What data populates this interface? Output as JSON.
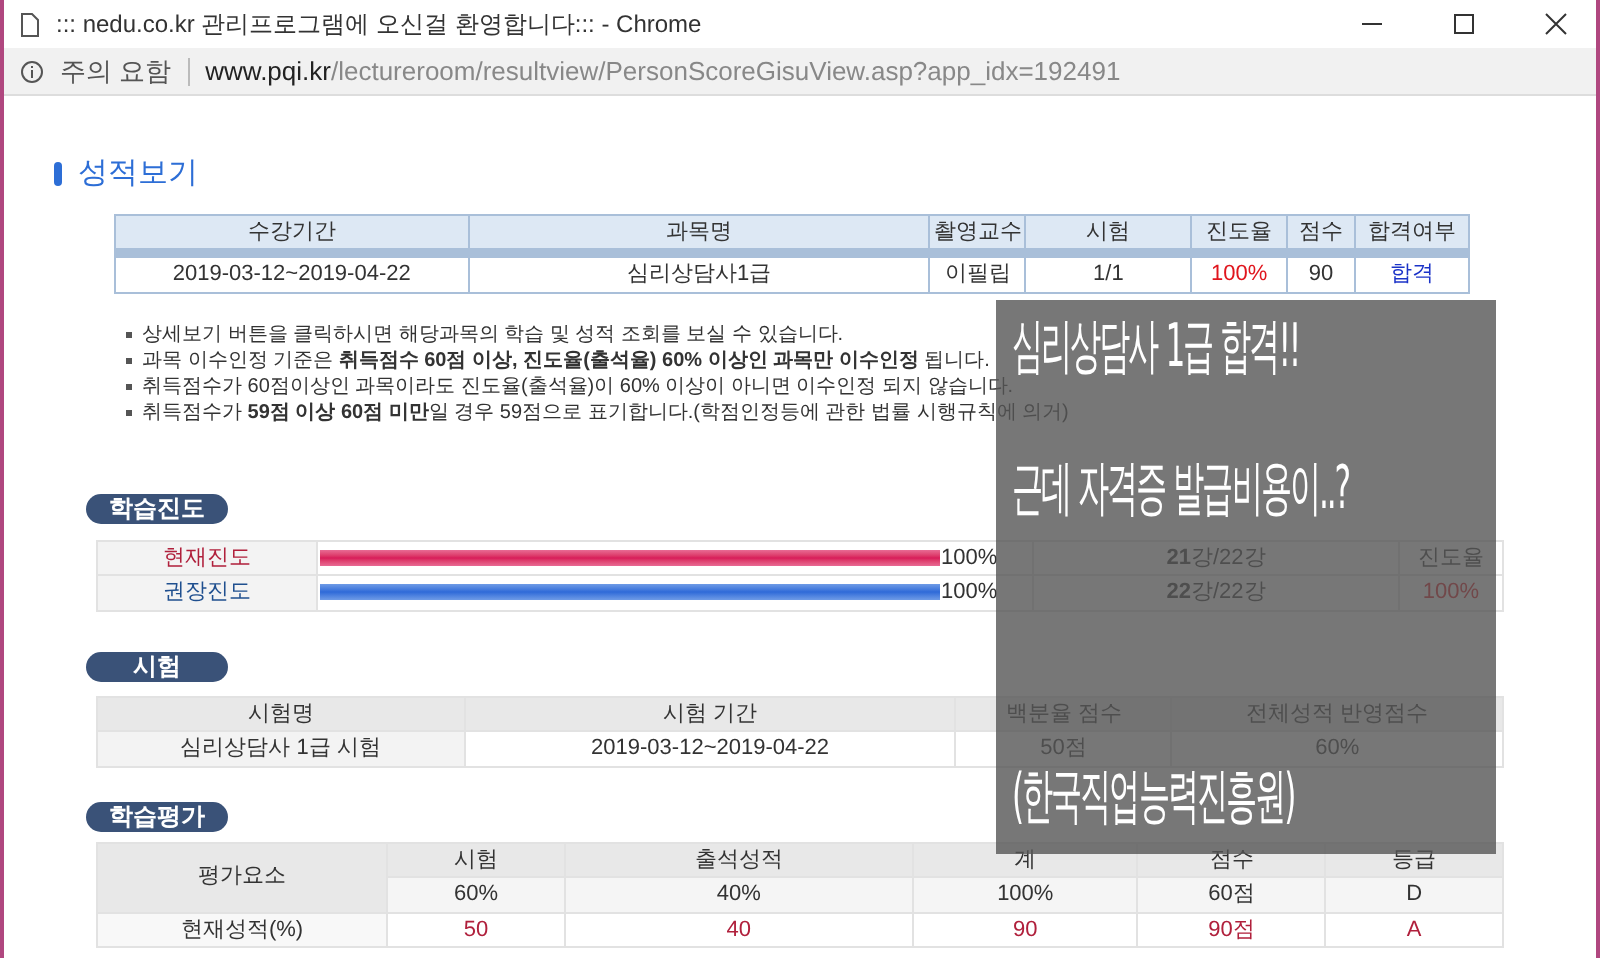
{
  "window": {
    "title": "::: nedu.co.kr 관리프로그램에 오신걸 환영합니다::: - Chrome"
  },
  "address_bar": {
    "security_label": "주의 요함",
    "host": "www.pqi.kr",
    "path": "/lectureroom/resultview/PersonScoreGisuView.asp?app_idx=192491"
  },
  "page_title": "성적보기",
  "course_table": {
    "columns": [
      "수강기간",
      "과목명",
      "촬영교수",
      "시험",
      "진도율",
      "점수",
      "합격여부"
    ],
    "rows": [
      [
        {
          "text": "2019-03-12~2019-04-22",
          "kind": "plain"
        },
        {
          "text": "심리상담사1급",
          "kind": "plain"
        },
        {
          "text": "이필립",
          "kind": "plain"
        },
        {
          "text": "1/1",
          "kind": "plain"
        },
        {
          "text": "100%",
          "kind": "alert"
        },
        {
          "text": "90",
          "kind": "plain"
        },
        {
          "text": "합격",
          "kind": "link"
        }
      ]
    ]
  },
  "notes": [
    "상세보기 버튼을 클릭하시면 해당과목의 학습 및 성적 조회를 보실 수 있습니다.",
    "과목 이수인정 기준은 **취득점수 60점 이상, 진도율(출석율) 60% 이상인 과목만 이수인정** 됩니다.",
    "취득점수가 60점이상인 과목이라도 진도율(출석율)이 60% 이상이 아니면 이수인정 되지 않습니다.",
    "취득점수가 **59점 이상 60점 미만**일 경우 59점으로 표기합니다.(학점인정등에 관한 법률 시행규칙에 의거)"
  ],
  "progress": {
    "heading": "학습진도",
    "rows": [
      {
        "label": "현재진도",
        "kind": "current",
        "level": 1,
        "reading": "100%",
        "lessons": "**21**강/22강",
        "column_4": {
          "text": "진도율",
          "kind": "header"
        }
      },
      {
        "label": "권장진도",
        "kind": "recommended",
        "level": 1,
        "reading": "100%",
        "lessons": "**22**강/22강",
        "column_4": {
          "text": "100%",
          "kind": "alert"
        }
      }
    ]
  },
  "exam": {
    "heading": "시험",
    "columns": [
      "시험명",
      "시험 기간",
      "백분율 점수",
      "전체성적 반영점수"
    ],
    "rows": [
      [
        "심리상담사 1급 시험",
        "2019-03-12~2019-04-22",
        "50점",
        "60%"
      ]
    ]
  },
  "evaluation": {
    "heading": "학습평가",
    "row_header": "평가요소",
    "columns": [
      "시험",
      "출석성적",
      "계",
      "점수",
      "등급"
    ],
    "weights": [
      "60%",
      "40%",
      "100%",
      "60점",
      "D"
    ],
    "rows": [
      {
        "label": "현재성적(%)",
        "values": [
          "50",
          "40",
          "90",
          "90점",
          "A"
        ]
      }
    ]
  },
  "overlay": {
    "lines": [
      "심리상담사 1급 합격!!",
      "근데 자격증 발급비용이..?",
      "(한국직업능력진흥원)"
    ]
  }
}
